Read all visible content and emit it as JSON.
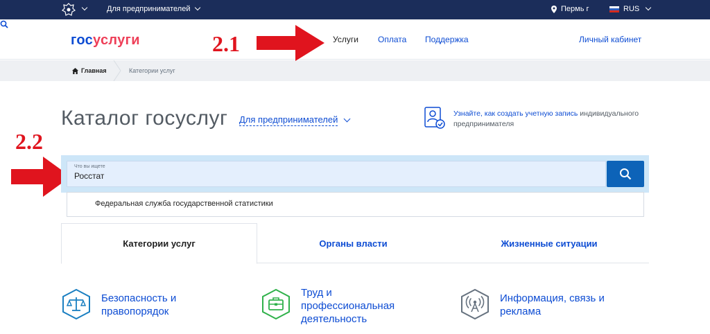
{
  "topbar": {
    "segment_label": "Для предпринимателей",
    "location": "Пермь г",
    "language": "RUS"
  },
  "header": {
    "logo_part1": "гос",
    "logo_part2": "услуги",
    "nav": {
      "services": "Услуги",
      "payment": "Оплата",
      "support": "Поддержка"
    },
    "cabinet": "Личный кабинет"
  },
  "breadcrumb": {
    "home": "Главная",
    "current": "Категории услуг"
  },
  "catalog": {
    "title": "Каталог госуслуг",
    "segment": "Для предпринимателей",
    "info_link": "Узнайте, как создать учетную запись",
    "info_rest": " индивидуального предпринимателя"
  },
  "annotations": {
    "step_1": "2.1",
    "step_2": "2.2"
  },
  "search": {
    "placeholder": "Что вы ищете",
    "value": "Росстат",
    "suggestion": "Федеральная служба государственной статистики"
  },
  "tabs": {
    "categories": "Категории услуг",
    "authorities": "Органы власти",
    "situations": "Жизненные ситуации"
  },
  "categories": [
    {
      "label": "Безопасность и правопорядок",
      "icon": "scales-icon",
      "color": "#1a7fc1"
    },
    {
      "label": "Труд и профессиональная деятельность",
      "icon": "briefcase-icon",
      "color": "#2fb14a"
    },
    {
      "label": "Информация, связь и реклама",
      "icon": "antenna-icon",
      "color": "#66727f"
    }
  ],
  "colors": {
    "topbar": "#1b2d5a",
    "link": "#0d4cd3",
    "logo_accent": "#ee3f58",
    "search_button": "#0d63b8",
    "annotation": "#e0141e"
  }
}
